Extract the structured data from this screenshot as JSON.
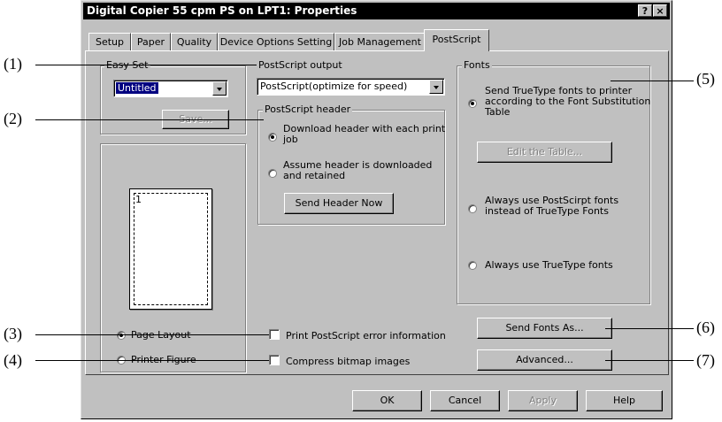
{
  "window": {
    "title": "Digital Copier 55 cpm PS on LPT1: Properties",
    "help_glyph": "?",
    "close_glyph": "×"
  },
  "tabs": [
    {
      "label": "Setup"
    },
    {
      "label": "Paper"
    },
    {
      "label": "Quality"
    },
    {
      "label": "Device Options Setting"
    },
    {
      "label": "Job Management"
    },
    {
      "label": "PostScript"
    }
  ],
  "easy_set": {
    "label": "Easy Set",
    "value": "Untitled",
    "save_label": "Save..."
  },
  "preview": {
    "page_number": "1",
    "page_layout_label": "Page Layout",
    "printer_figure_label": "Printer Figure"
  },
  "postscript_output": {
    "label": "PostScript output",
    "value": "PostScript(optimize for speed)"
  },
  "postscript_header": {
    "label": "PostScript header",
    "option1_line1": "Download header with each print",
    "option1_line2": "job",
    "option2_line1": "Assume header is downloaded",
    "option2_line2": "and retained",
    "send_header_label": "Send Header Now"
  },
  "checkboxes": {
    "print_error": "Print PostScript error information",
    "compress_bitmap": "Compress bitmap images"
  },
  "fonts": {
    "label": "Fonts",
    "option1_line1": "Send TrueType fonts to printer",
    "option1_line2": "according to the Font Substitution",
    "option1_line3": "Table",
    "edit_table_label": "Edit the Table...",
    "option2_line1": "Always use PostScirpt fonts",
    "option2_line2": "instead of TrueType Fonts",
    "option3_line1": "Always use TrueType fonts",
    "send_fonts_as_label": "Send Fonts As...",
    "advanced_label": "Advanced..."
  },
  "dialog_buttons": {
    "ok": "OK",
    "cancel": "Cancel",
    "apply": "Apply",
    "help": "Help"
  },
  "callouts": {
    "c1": "(1)",
    "c2": "(2)",
    "c3": "(3)",
    "c4": "(4)",
    "c5": "(5)",
    "c6": "(6)",
    "c7": "(7)"
  }
}
